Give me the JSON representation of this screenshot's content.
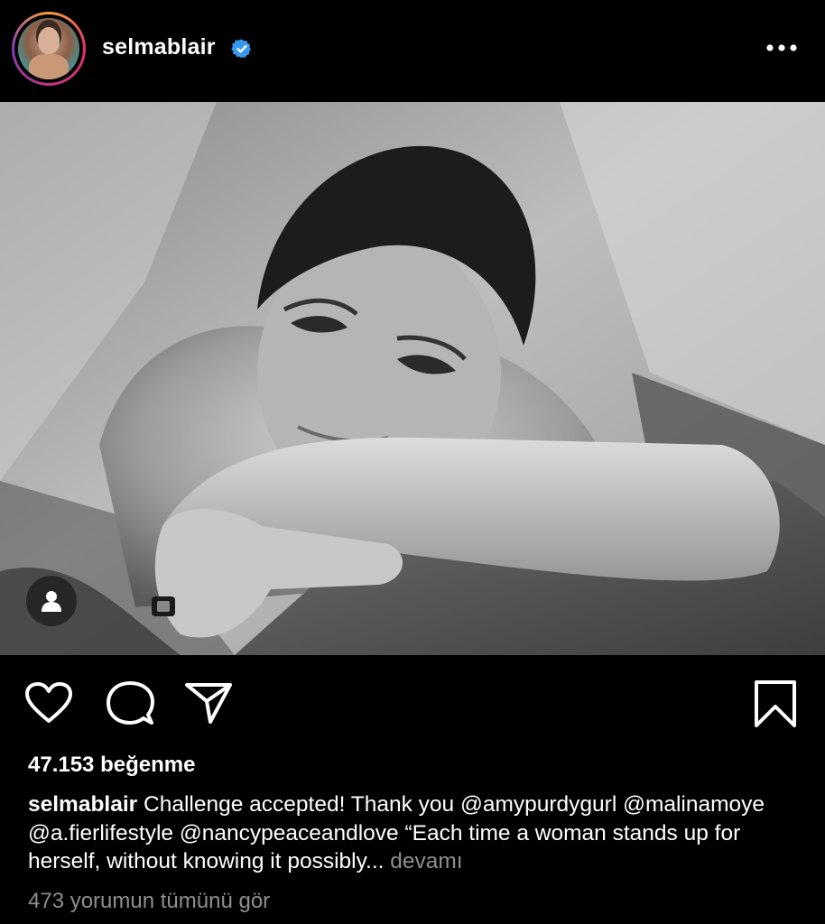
{
  "header": {
    "username": "selmablair",
    "verified": true,
    "avatar_alt": "selmablair profile picture"
  },
  "icons": {
    "verified": "verified-badge-icon",
    "more": "more-horizontal-icon",
    "user_tag": "person-icon",
    "like": "heart-icon",
    "comment": "comment-bubble-icon",
    "share": "paper-plane-icon",
    "save": "bookmark-icon"
  },
  "colors": {
    "background": "#000000",
    "text": "#ffffff",
    "muted": "#8e8e8e",
    "verified_blue": "#3897f0"
  },
  "post": {
    "likes": "47.153 beğenme",
    "caption_user": "selmablair",
    "caption_text": "Challenge accepted! Thank you @amypurdygurl @malinamoye @a.fierlifestyle @nancypeaceandlove “Each time a woman stands up for herself, without knowing it possibly...",
    "more_label": "devamı",
    "view_comments": "473 yorumun tümünü gör"
  }
}
